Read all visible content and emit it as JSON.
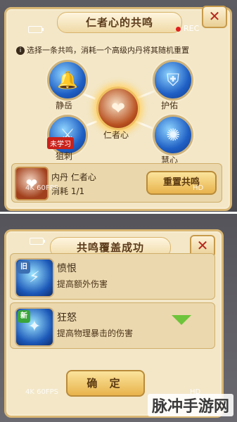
{
  "top_panel": {
    "title": "仁者心的共鸣",
    "instruction": "选择一条共鸣，消耗一个高级内丹将其随机重置",
    "info_icon": "i",
    "close_label": "✕",
    "rec_label": "REC",
    "nodes": {
      "jingyue": "静岳",
      "huyou": "护佑",
      "center": "仁者心",
      "juci": "狙刺",
      "huixin": "慧心"
    },
    "unlearned_badge": "未学习",
    "item": {
      "line1": "内丹  仁者心",
      "line2": "消耗  1/1"
    },
    "reset_button": "重置共鸣",
    "overlay_left": "4K 60FPS",
    "overlay_right": "HD"
  },
  "bottom_panel": {
    "title": "共鸣覆盖成功",
    "close_label": "✕",
    "skills": [
      {
        "tag": "旧",
        "name": "愤恨",
        "desc": "提高额外伤害"
      },
      {
        "tag": "新",
        "name": "狂怒",
        "desc": "提高物理暴击的伤害"
      }
    ],
    "confirm_button": "确 定",
    "overlay_left": "4K 60FPS",
    "overlay_right": "HD"
  },
  "watermark": "脉冲手游网",
  "colors": {
    "panel_bg": "#f3e7c8",
    "border_gold": "#d9b774",
    "node_blue": "#1f5fc4",
    "center_orange": "#b8501f",
    "unlearned_red": "#c9211b",
    "new_green": "#3aa53a",
    "old_blue": "#3b6fb2",
    "button_gold": "#e8b34c"
  }
}
